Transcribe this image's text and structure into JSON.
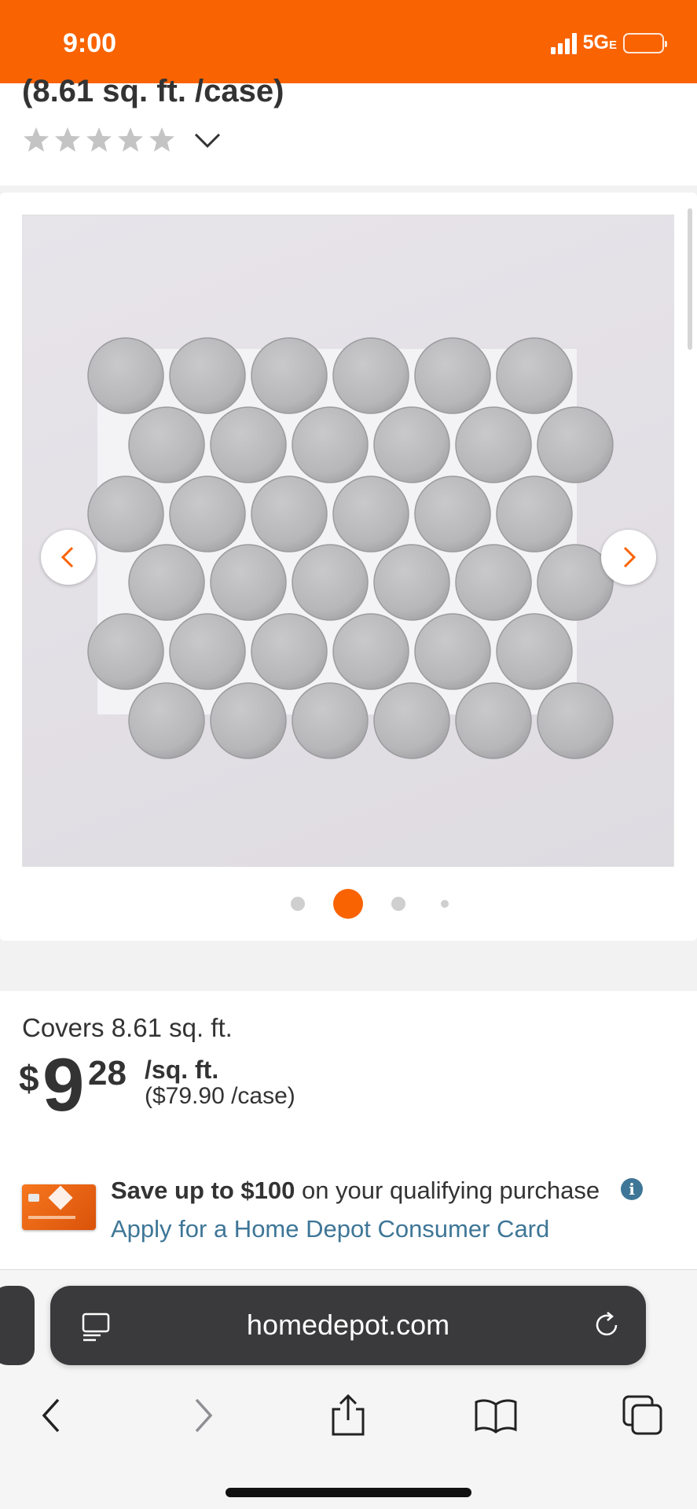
{
  "status_bar": {
    "time": "9:00",
    "network": "5G",
    "network_suffix": "E",
    "icons": [
      "signal-bars-icon",
      "battery-icon"
    ],
    "background": "#f96302"
  },
  "product": {
    "title_fragment": "(8.61 sq. ft. /case)",
    "rating_stars": 5,
    "rating_filled": 0,
    "image_alt": "Gray round penny mosaic tile sheet",
    "carousel": {
      "dot_count": 4,
      "active_index": 1
    }
  },
  "pricing": {
    "covers": "Covers 8.61 sq. ft.",
    "currency": "$",
    "dollars": "9",
    "cents": "28",
    "unit": "/sq. ft.",
    "per_case": "($79.90 /case)"
  },
  "promo": {
    "save_bold": "Save up to $100",
    "save_rest": " on your qualifying purchase",
    "apply_link": "Apply for a Home Depot Consumer Card"
  },
  "browser": {
    "url": "homedepot.com",
    "icons": [
      "reader-icon",
      "reload-icon",
      "back-icon",
      "forward-icon",
      "share-icon",
      "bookmarks-icon",
      "tabs-icon"
    ]
  },
  "colors": {
    "brand_orange": "#f96302",
    "link_blue": "#3e7697",
    "text_dark": "#333333"
  }
}
